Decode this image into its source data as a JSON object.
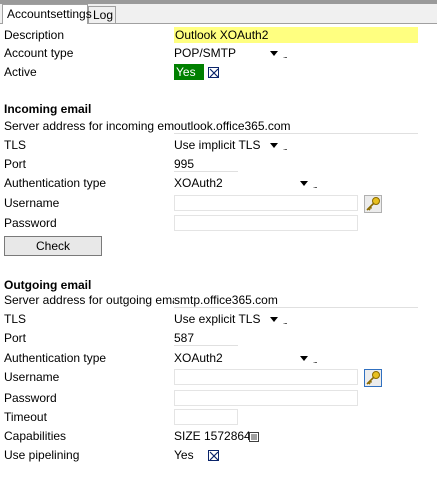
{
  "tabs": [
    {
      "label": "Accountsettings"
    },
    {
      "label": "Log"
    }
  ],
  "general": {
    "description_label": "Description",
    "description_value": "Outlook XOAuth2",
    "account_type_label": "Account type",
    "account_type_value": "POP/SMTP",
    "active_label": "Active",
    "active_value": "Yes"
  },
  "incoming": {
    "heading": "Incoming email",
    "server_label": "Server address for incoming email",
    "server_value": "outlook.office365.com",
    "tls_label": "TLS",
    "tls_value": "Use implicit TLS",
    "port_label": "Port",
    "port_value": "995",
    "auth_label": "Authentication type",
    "auth_value": "XOAuth2",
    "username_label": "Username",
    "username_value": "",
    "password_label": "Password",
    "password_value": "",
    "check_button": "Check"
  },
  "outgoing": {
    "heading": "Outgoing email",
    "server_label": "Server address for outgoing email",
    "server_value": "smtp.office365.com",
    "tls_label": "TLS",
    "tls_value": "Use explicit TLS",
    "port_label": "Port",
    "port_value": "587",
    "auth_label": "Authentication type",
    "auth_value": "XOAuth2",
    "username_label": "Username",
    "username_value": "",
    "password_label": "Password",
    "password_value": "",
    "timeout_label": "Timeout",
    "timeout_value": "",
    "capabilities_label": "Capabilities",
    "capabilities_value": "SIZE 1572864",
    "pipelining_label": "Use pipelining",
    "pipelining_value": "Yes"
  },
  "colors": {
    "description_highlight": "#ffff80",
    "active_green": "#008000",
    "checkbox_border": "#0a246a"
  },
  "icons": {
    "key": "key-icon",
    "capabilities": "list-icon",
    "checkbox": "checkbox-icon"
  }
}
